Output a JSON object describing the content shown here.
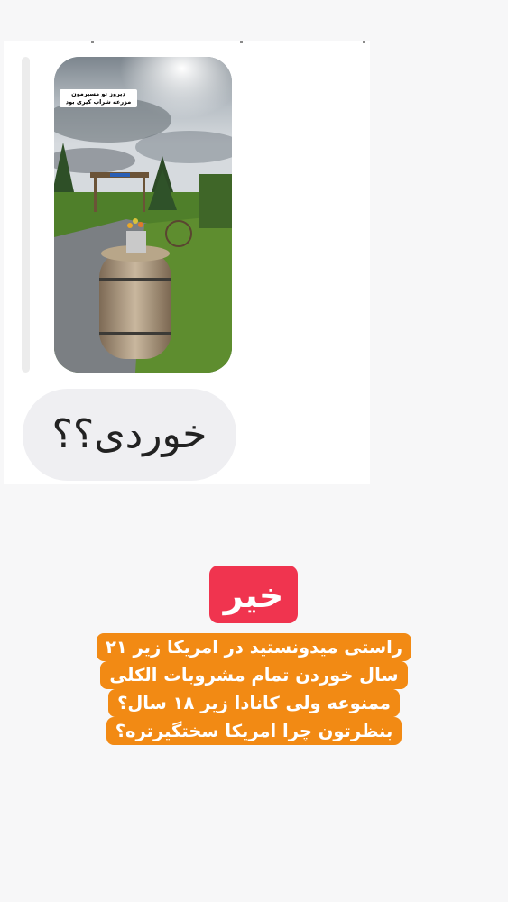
{
  "story": {
    "caption": "دیروز تو مسیرمون مزرعه شراب کیری بود"
  },
  "reply": {
    "message": "خوردی؟؟"
  },
  "answer": {
    "label": "خیر",
    "question_lines": [
      "راستی میدونستید در امریکا زیر ۲۱",
      "سال خوردن تمام مشروبات الکلی",
      "ممنوعه ولی کانادا زیر ۱۸ سال؟",
      "بنظرتون چرا امریکا سختگیرتره؟"
    ],
    "colors": {
      "badge": "#f0344f",
      "question_bg": "#f28a14"
    }
  }
}
